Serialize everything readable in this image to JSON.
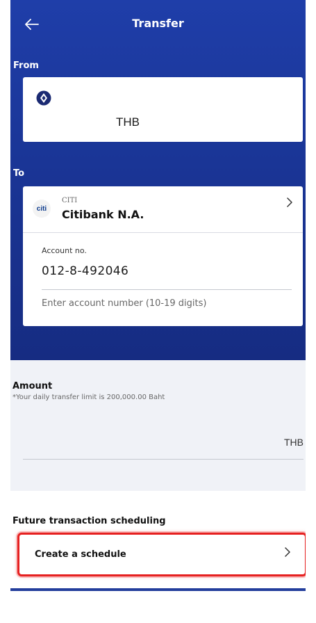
{
  "header": {
    "title": "Transfer",
    "back_icon": "arrow-left-icon"
  },
  "from": {
    "label": "From",
    "bank_icon": "krungsri-logo-icon",
    "currency": "THB"
  },
  "to": {
    "label": "To",
    "bank_logo_text": "citi",
    "bank_code": "CITI",
    "bank_name": "Citibank N.A.",
    "account_label": "Account no.",
    "account_value": "012-8-492046",
    "account_hint": "Enter account number (10-19 digits)"
  },
  "amount": {
    "title": "Amount",
    "limit_note": "*Your daily transfer limit is 200,000.00 Baht",
    "currency": "THB",
    "value": ""
  },
  "schedule": {
    "title": "Future transaction scheduling",
    "button_label": "Create a schedule"
  },
  "colors": {
    "header_blue": "#1a3596",
    "highlight_red": "#e62020",
    "background_gray": "#f0f2f7"
  }
}
